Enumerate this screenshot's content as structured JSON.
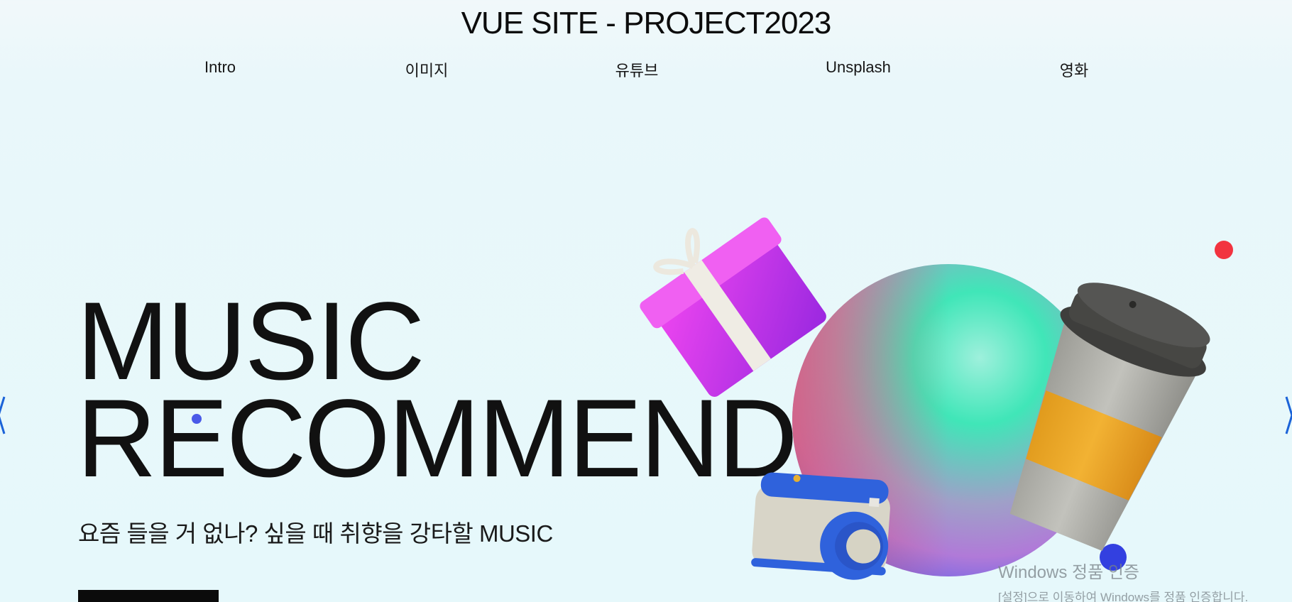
{
  "site": {
    "title": "VUE SITE - PROJECT2023"
  },
  "nav": {
    "items": [
      {
        "label": "Intro"
      },
      {
        "label": "이미지"
      },
      {
        "label": "유튜브"
      },
      {
        "label": "Unsplash"
      },
      {
        "label": "영화"
      }
    ]
  },
  "hero": {
    "line1": "MUSIC",
    "line2": "RECOMMEND",
    "subtitle": "요즘 들을 거 없나? 싶을 때 취향을 강타할 MUSIC"
  },
  "illustration": {
    "objects": [
      "gift-box",
      "gradient-sphere",
      "coffee-cup",
      "camera"
    ]
  },
  "colors": {
    "accent_red": "#f2333f",
    "accent_blue": "#3340e0",
    "dot_blue": "#4a5ae8",
    "arrow_blue": "#1b63d8"
  },
  "watermark": {
    "title": "Windows 정품 인증",
    "subtitle": "[설정]으로 이동하여 Windows를 정품 인증합니다."
  }
}
